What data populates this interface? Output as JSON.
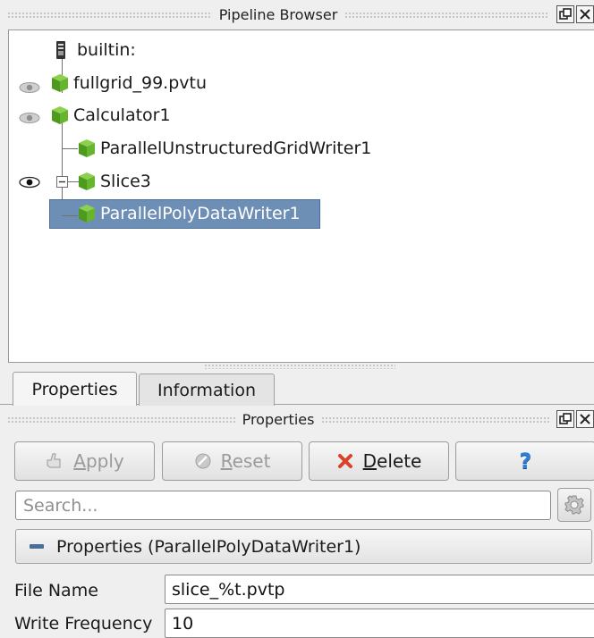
{
  "pipeline_browser": {
    "title": "Pipeline Browser",
    "items": [
      {
        "label": "builtin:",
        "icon": "server-icon",
        "visible": null
      },
      {
        "label": "fullgrid_99.pvtu",
        "icon": "source-cube-icon",
        "visible": "hidden"
      },
      {
        "label": "Calculator1",
        "icon": "filter-cube-icon",
        "visible": "hidden"
      },
      {
        "label": "ParallelUnstructuredGridWriter1",
        "icon": "filter-cube-icon",
        "visible": null
      },
      {
        "label": "Slice3",
        "icon": "filter-cube-icon",
        "visible": "shown"
      },
      {
        "label": "ParallelPolyDataWriter1",
        "icon": "filter-cube-icon",
        "visible": null,
        "selected": true
      }
    ]
  },
  "tabs": [
    {
      "label": "Properties",
      "active": true
    },
    {
      "label": "Information",
      "active": false
    }
  ],
  "properties_panel": {
    "title": "Properties",
    "buttons": {
      "apply": "Apply",
      "reset": "Reset",
      "delete": "Delete",
      "help": "?"
    },
    "search_placeholder": "Search...",
    "section_title": "Properties (ParallelPolyDataWriter1)",
    "fields": [
      {
        "label": "File Name",
        "value": "slice_%t.pvtp"
      },
      {
        "label": "Write Frequency",
        "value": "10"
      }
    ]
  },
  "colors": {
    "selection": "#6d8fb6",
    "cube_green": "#5aa02c",
    "delete_red": "#d9432a",
    "help_blue": "#2f7fd6"
  }
}
